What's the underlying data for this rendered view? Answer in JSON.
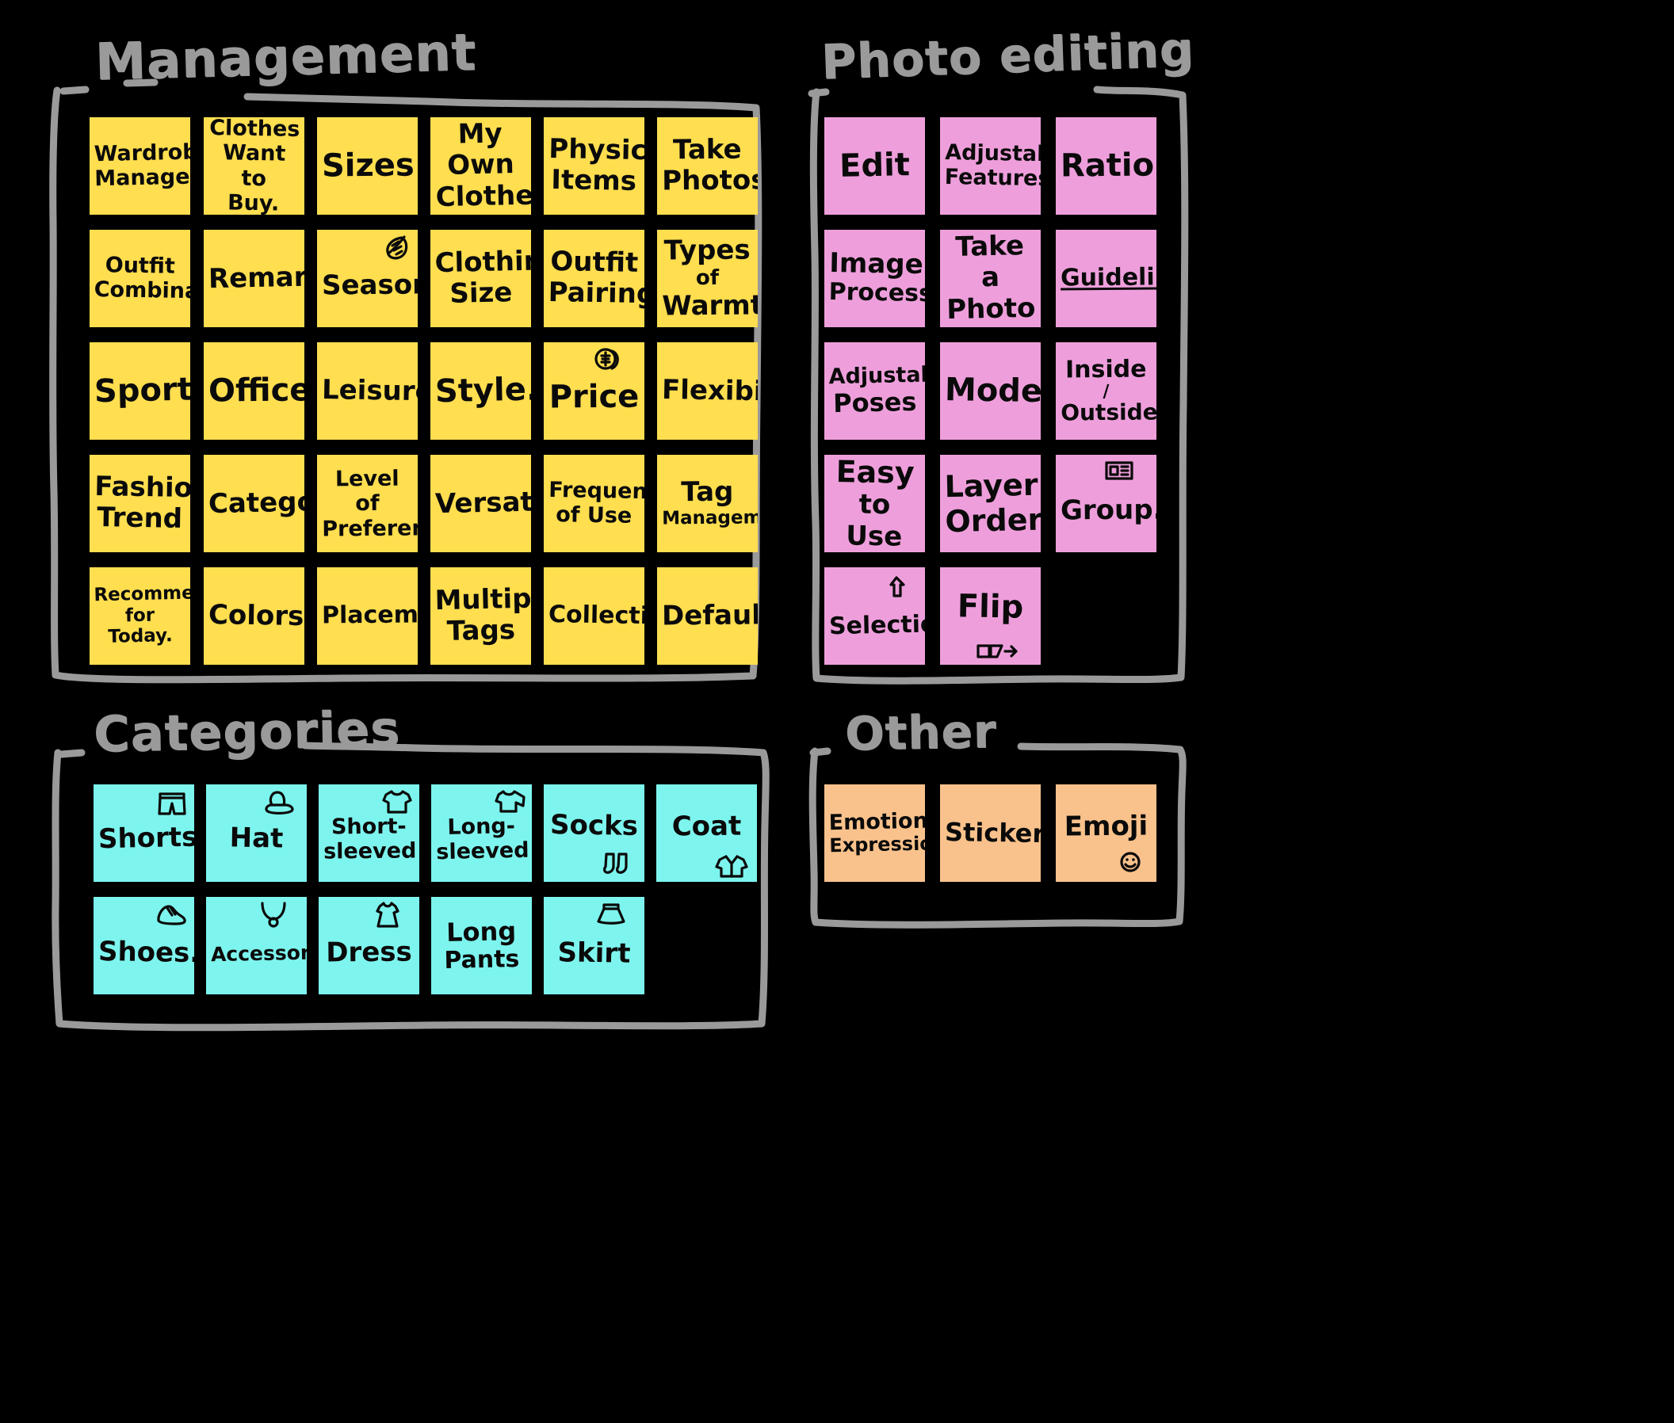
{
  "board": {
    "background_color": "#000000",
    "frame_color": "#9a9a9a",
    "note_colors": {
      "management": "#FFDE4F",
      "photo_editing": "#EE9FDB",
      "categories": "#7DF5EE",
      "other": "#F9C28C"
    }
  },
  "groups": {
    "management": {
      "title": "Management",
      "notes": [
        {
          "lines": [
            "Wardrobe",
            "Management"
          ],
          "size": "t-sm",
          "icon": null
        },
        {
          "lines": [
            "Clothes",
            "Want to",
            "Buy."
          ],
          "size": "t-sm",
          "icon": null
        },
        {
          "lines": [
            "Sizes"
          ],
          "size": "t-lg",
          "icon": null
        },
        {
          "lines": [
            "My Own",
            "Clothes"
          ],
          "size": "t-md",
          "icon": null
        },
        {
          "lines": [
            "Physical",
            "Items"
          ],
          "size": "t-md",
          "icon": null
        },
        {
          "lines": [
            "Take",
            "Photos"
          ],
          "size": "t-md",
          "icon": null
        },
        {
          "lines": [
            "Outfit",
            "Combinations"
          ],
          "size": "t-sm",
          "icon": null
        },
        {
          "lines": [
            "Remarks"
          ],
          "size": "t-md",
          "icon": null
        },
        {
          "lines": [
            "Seasons"
          ],
          "size": "t-md",
          "icon": "leaf-icon"
        },
        {
          "lines": [
            "Clothing",
            "Size"
          ],
          "size": "t-md",
          "icon": null
        },
        {
          "lines": [
            "Outfit",
            "Pairing"
          ],
          "size": "t-md",
          "icon": null
        },
        {
          "lines": [
            "Types",
            "of",
            "Warmth"
          ],
          "size": "t-md",
          "icon": null
        },
        {
          "lines": [
            "Sports"
          ],
          "size": "t-lg",
          "icon": null
        },
        {
          "lines": [
            "Office"
          ],
          "size": "t-lg",
          "icon": null
        },
        {
          "lines": [
            "Leisure"
          ],
          "size": "t-md",
          "icon": null
        },
        {
          "lines": [
            "Style."
          ],
          "size": "t-lg",
          "icon": null
        },
        {
          "lines": [
            "Price"
          ],
          "size": "t-lg",
          "icon": "coin-icon"
        },
        {
          "lines": [
            "Flexibility"
          ],
          "size": "t-md",
          "icon": null
        },
        {
          "lines": [
            "Fashion",
            "Trend"
          ],
          "size": "t-md",
          "icon": null
        },
        {
          "lines": [
            "Category"
          ],
          "size": "t-md",
          "icon": null
        },
        {
          "lines": [
            "Level of",
            "Preference"
          ],
          "size": "t-sm",
          "icon": null
        },
        {
          "lines": [
            "Versatility"
          ],
          "size": "t-md",
          "icon": null
        },
        {
          "lines": [
            "Frequency",
            "of Use"
          ],
          "size": "t-sm",
          "icon": null
        },
        {
          "lines": [
            "Tag",
            "Management"
          ],
          "size": "t-sm",
          "icon": null
        },
        {
          "lines": [
            "Recommended",
            "for Today."
          ],
          "size": "t-xs",
          "icon": null
        },
        {
          "lines": [
            "Colors."
          ],
          "size": "t-md",
          "icon": null
        },
        {
          "lines": [
            "Placement"
          ],
          "size": "t-md",
          "icon": null
        },
        {
          "lines": [
            "Multiple",
            "Tags"
          ],
          "size": "t-md",
          "icon": null
        },
        {
          "lines": [
            "Collection"
          ],
          "size": "t-md",
          "icon": null
        },
        {
          "lines": [
            "Default"
          ],
          "size": "t-md",
          "icon": null
        }
      ]
    },
    "photo_editing": {
      "title": "Photo editing",
      "notes": [
        {
          "lines": [
            "Edit"
          ],
          "size": "t-lg",
          "icon": null
        },
        {
          "lines": [
            "Adjustable",
            "Features"
          ],
          "size": "t-sm",
          "icon": null
        },
        {
          "lines": [
            "Ratio"
          ],
          "size": "t-lg",
          "icon": null
        },
        {
          "lines": [
            "Image",
            "Processing"
          ],
          "size": "t-md",
          "icon": null
        },
        {
          "lines": [
            "Take a",
            "Photo"
          ],
          "size": "t-md",
          "icon": null
        },
        {
          "lines": [
            "Guidelines"
          ],
          "size": "t-md",
          "icon": null,
          "underline": true
        },
        {
          "lines": [
            "Adjustable",
            "Poses"
          ],
          "size": "t-sm",
          "icon": null
        },
        {
          "lines": [
            "Model"
          ],
          "size": "t-lg",
          "icon": null
        },
        {
          "lines": [
            "Inside",
            "/",
            "Outside"
          ],
          "size": "t-sm",
          "icon": null
        },
        {
          "lines": [
            "Easy",
            "to Use"
          ],
          "size": "t-md",
          "icon": null
        },
        {
          "lines": [
            "Layer",
            "Order"
          ],
          "size": "t-md",
          "icon": null
        },
        {
          "lines": [
            "Group."
          ],
          "size": "t-md",
          "icon": "group-icon"
        },
        {
          "lines": [
            "Selection"
          ],
          "size": "t-md",
          "icon": "cursor-icon"
        },
        {
          "lines": [
            "Flip"
          ],
          "size": "t-lg",
          "icon": "flip-icon"
        }
      ]
    },
    "categories": {
      "title": "Categories",
      "notes": [
        {
          "lines": [
            "Shorts"
          ],
          "size": "t-md",
          "icon": "shorts-icon"
        },
        {
          "lines": [
            "Hat"
          ],
          "size": "t-md",
          "icon": "hat-icon"
        },
        {
          "lines": [
            "Short-",
            "sleeved"
          ],
          "size": "t-sm",
          "icon": "tshirt-icon"
        },
        {
          "lines": [
            "Long-",
            "sleeved"
          ],
          "size": "t-sm",
          "icon": "longsleeve-icon"
        },
        {
          "lines": [
            "Socks"
          ],
          "size": "t-md",
          "icon": "socks-icon"
        },
        {
          "lines": [
            "Coat"
          ],
          "size": "t-md",
          "icon": "coat-icon"
        },
        {
          "lines": [
            "Shoes."
          ],
          "size": "t-md",
          "icon": "shoe-icon"
        },
        {
          "lines": [
            "Accessories"
          ],
          "size": "t-sm",
          "icon": "necklace-icon"
        },
        {
          "lines": [
            "Dress"
          ],
          "size": "t-md",
          "icon": "dress-icon"
        },
        {
          "lines": [
            "Long",
            "Pants"
          ],
          "size": "t-sm",
          "icon": null
        },
        {
          "lines": [
            "Skirt"
          ],
          "size": "t-md",
          "icon": "skirt-icon"
        }
      ]
    },
    "other": {
      "title": "Other",
      "notes": [
        {
          "lines": [
            "Emotion",
            "Expression"
          ],
          "size": "t-sm",
          "icon": null
        },
        {
          "lines": [
            "Sticker"
          ],
          "size": "t-md",
          "icon": null
        },
        {
          "lines": [
            "Emoji"
          ],
          "size": "t-md",
          "icon": "smiley-icon"
        }
      ]
    }
  }
}
